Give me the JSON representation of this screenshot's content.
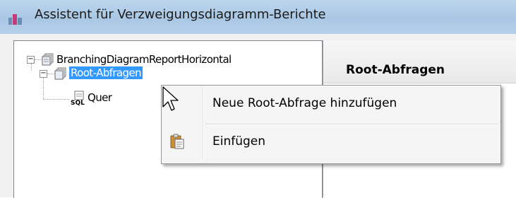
{
  "window": {
    "title": "Assistent für Verzweigungsdiagramm-Berichte",
    "icon": "app-icon"
  },
  "tree": {
    "root": {
      "label": "BranchingDiagramReportHorizontal",
      "expanded": true,
      "icon": "report-icon"
    },
    "child": {
      "label": "Root-Abfragen",
      "expanded": true,
      "selected": true,
      "icon": "folder-icon"
    },
    "grandchild": {
      "label": "Quer",
      "icon": "sql-icon"
    }
  },
  "right_panel": {
    "header": "Root-Abfragen"
  },
  "context_menu": {
    "items": [
      {
        "label": "Neue Root-Abfrage hinzufügen",
        "icon": ""
      },
      {
        "label": "Einfügen",
        "icon": "paste-icon"
      }
    ]
  },
  "colors": {
    "selection": "#3399ff",
    "titlebar": "#b2cde8"
  }
}
